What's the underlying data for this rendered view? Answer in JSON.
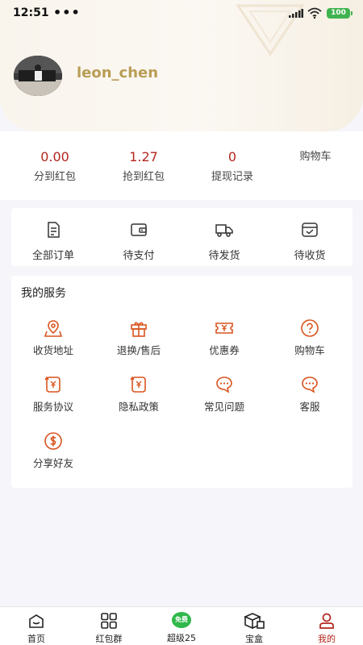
{
  "status_bar": {
    "time": "12:51",
    "dots": "•••",
    "battery": "100"
  },
  "profile": {
    "username": "leon_chen"
  },
  "stats": [
    {
      "value": "0.00",
      "label": "分到红包"
    },
    {
      "value": "1.27",
      "label": "抢到红包"
    },
    {
      "value": "0",
      "label": "提现记录"
    },
    {
      "value": "",
      "label": "购物车"
    }
  ],
  "orders": [
    {
      "label": "全部订单",
      "icon": "order-list-icon"
    },
    {
      "label": "待支付",
      "icon": "wallet-icon"
    },
    {
      "label": "待发货",
      "icon": "truck-icon"
    },
    {
      "label": "待收货",
      "icon": "inbox-check-icon"
    }
  ],
  "services": {
    "title": "我的服务",
    "items": [
      {
        "label": "收货地址",
        "icon": "location-icon"
      },
      {
        "label": "退换/售后",
        "icon": "gift-icon"
      },
      {
        "label": "优惠券",
        "icon": "coupon-icon"
      },
      {
        "label": "购物车",
        "icon": "question-icon"
      },
      {
        "label": "服务协议",
        "icon": "refresh-yen-icon"
      },
      {
        "label": "隐私政策",
        "icon": "refresh-yen-icon"
      },
      {
        "label": "常见问题",
        "icon": "chat-icon"
      },
      {
        "label": "客服",
        "icon": "chat-icon"
      },
      {
        "label": "分享好友",
        "icon": "dollar-circle-icon"
      }
    ]
  },
  "tabbar": {
    "items": [
      {
        "label": "首页",
        "icon": "home-icon"
      },
      {
        "label": "红包群",
        "icon": "grid-icon"
      },
      {
        "label": "超级25",
        "icon": "free-badge-icon",
        "badge": "免费"
      },
      {
        "label": "宝盒",
        "icon": "box-icon"
      },
      {
        "label": "我的",
        "icon": "user-icon"
      }
    ],
    "active_index": 4
  },
  "colors": {
    "accent": "#b3261e",
    "icon_orange": "#d9541e",
    "gold": "#b89d55",
    "badge_green": "#2fb84a"
  }
}
